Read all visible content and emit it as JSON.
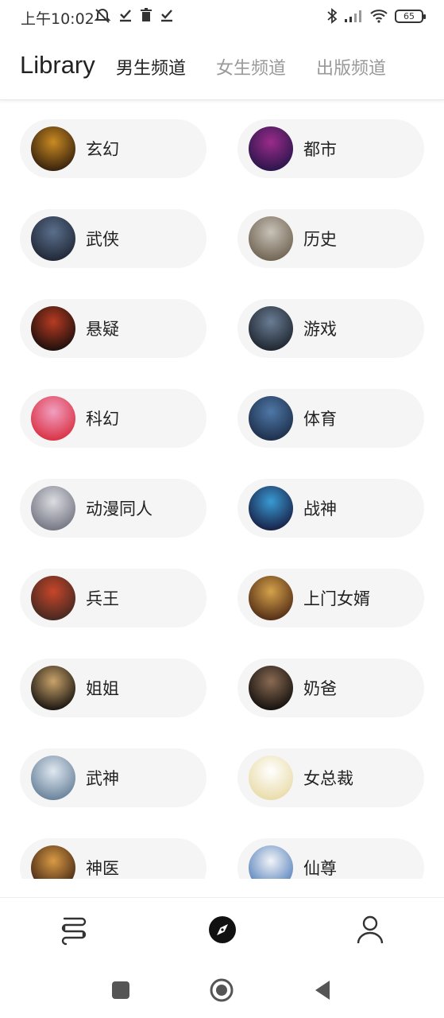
{
  "status": {
    "time": "上午10:02",
    "battery": "65"
  },
  "header": {
    "title": "Library",
    "tabs": [
      "男生频道",
      "女生频道",
      "出版频道"
    ],
    "active_tab": 0
  },
  "categories": [
    {
      "label": "玄幻",
      "cover_colors": [
        "#c98a22",
        "#2d1a0c"
      ]
    },
    {
      "label": "都市",
      "cover_colors": [
        "#9b2b8a",
        "#221447"
      ]
    },
    {
      "label": "武侠",
      "cover_colors": [
        "#5a6f8c",
        "#1d2331"
      ]
    },
    {
      "label": "历史",
      "cover_colors": [
        "#c8c2b8",
        "#6b5e4c"
      ]
    },
    {
      "label": "悬疑",
      "cover_colors": [
        "#b63b22",
        "#140d0b"
      ]
    },
    {
      "label": "游戏",
      "cover_colors": [
        "#6a7d94",
        "#1a2029"
      ]
    },
    {
      "label": "科幻",
      "cover_colors": [
        "#f19fc0",
        "#d82a3c"
      ]
    },
    {
      "label": "体育",
      "cover_colors": [
        "#4f78a8",
        "#1a2a44"
      ]
    },
    {
      "label": "动漫同人",
      "cover_colors": [
        "#dcdde2",
        "#6d6f7c"
      ]
    },
    {
      "label": "战神",
      "cover_colors": [
        "#3a9bd4",
        "#15183d"
      ]
    },
    {
      "label": "兵王",
      "cover_colors": [
        "#c7462a",
        "#3b2620"
      ]
    },
    {
      "label": "上门女婿",
      "cover_colors": [
        "#d6a24a",
        "#4a2613"
      ]
    },
    {
      "label": "姐姐",
      "cover_colors": [
        "#c9a36a",
        "#0e0c0b"
      ]
    },
    {
      "label": "奶爸",
      "cover_colors": [
        "#8a6b53",
        "#0c0a09"
      ]
    },
    {
      "label": "武神",
      "cover_colors": [
        "#dfe8f0",
        "#617b95"
      ]
    },
    {
      "label": "女总裁",
      "cover_colors": [
        "#ffffff",
        "#e8d9a3"
      ]
    },
    {
      "label": "神医",
      "cover_colors": [
        "#d99a45",
        "#3a1f10"
      ]
    },
    {
      "label": "仙尊",
      "cover_colors": [
        "#f2f4f7",
        "#4d7bb8"
      ]
    }
  ],
  "bottom_nav": {
    "items": [
      "bookshelf-icon",
      "compass-icon",
      "profile-icon"
    ],
    "active": 1
  },
  "system_nav": [
    "recents-button",
    "home-button",
    "back-button"
  ]
}
